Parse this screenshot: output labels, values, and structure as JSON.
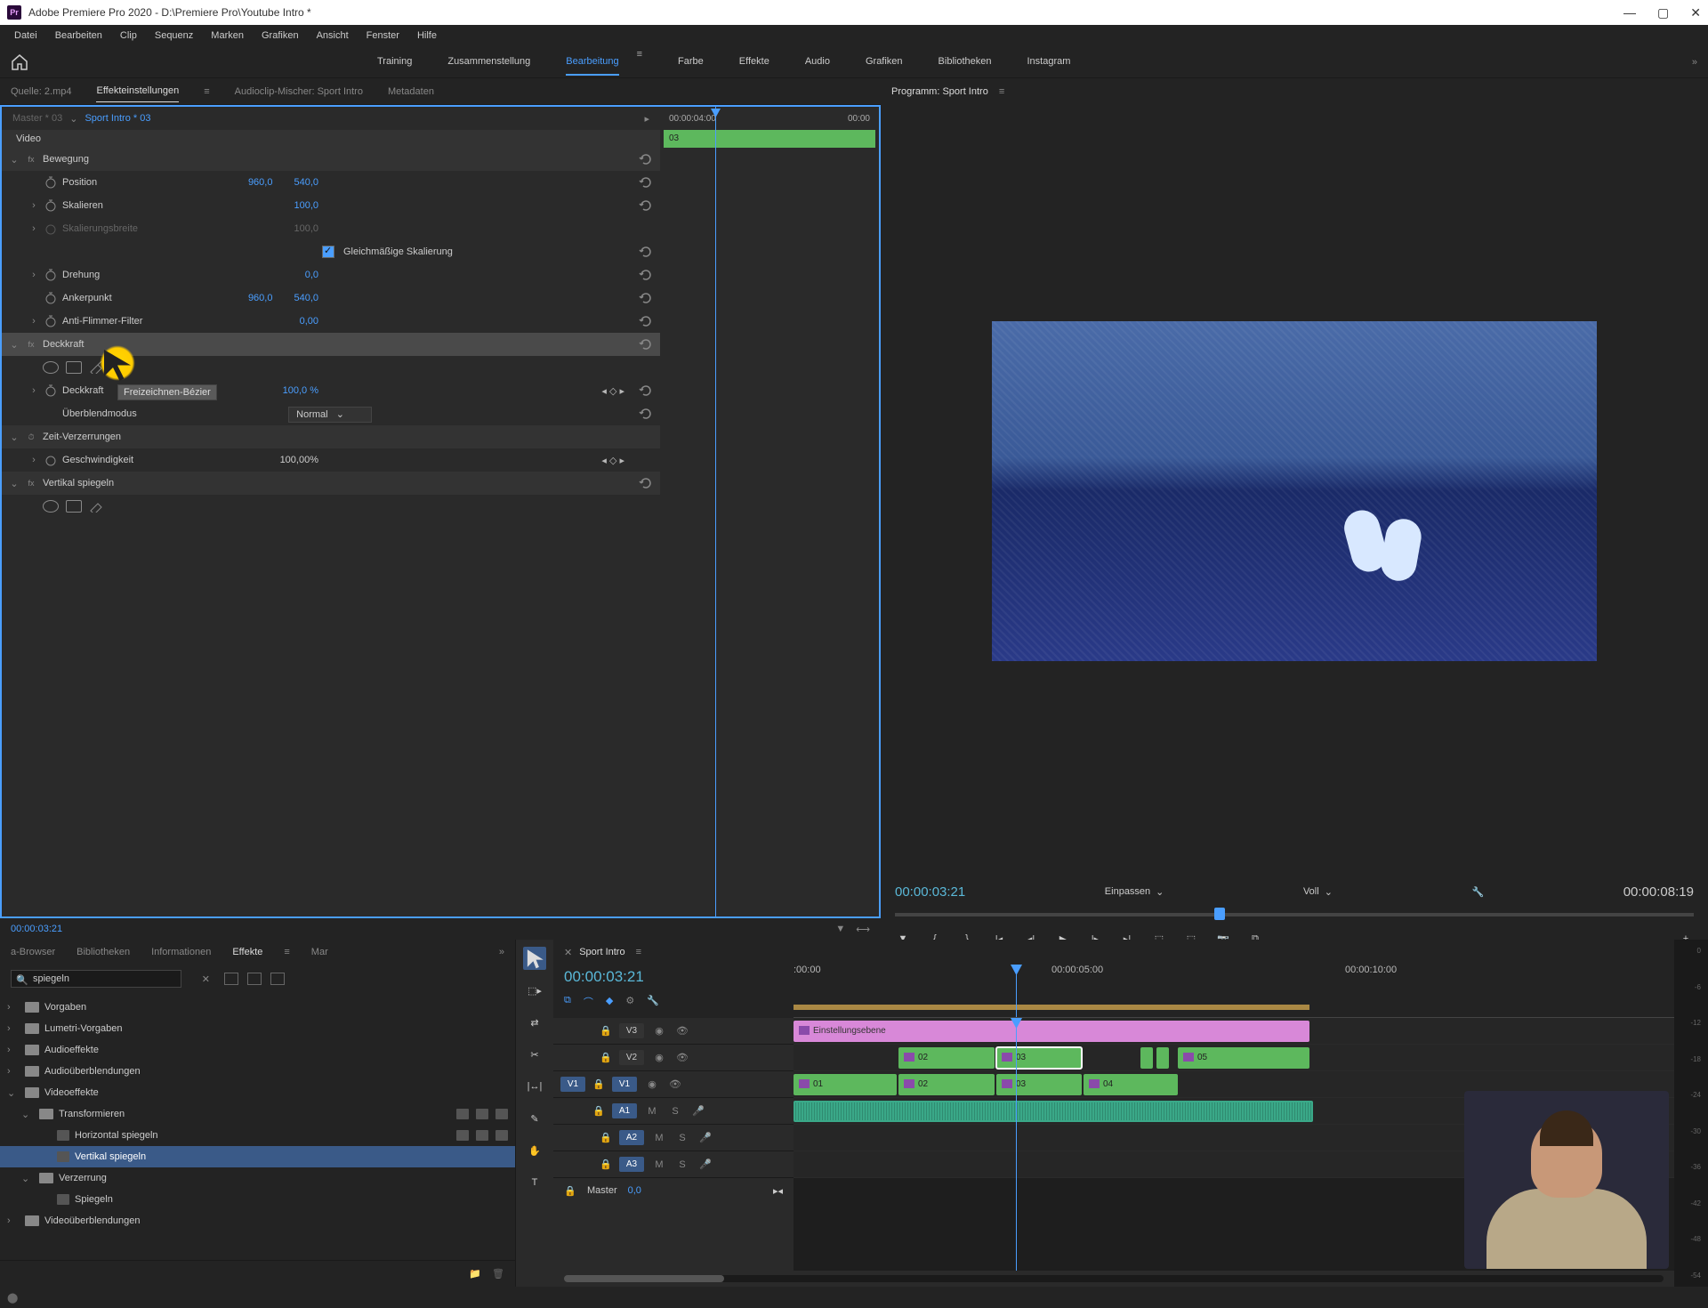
{
  "titlebar": {
    "app_icon_text": "Pr",
    "title": "Adobe Premiere Pro 2020 - D:\\Premiere Pro\\Youtube Intro *"
  },
  "menubar": [
    "Datei",
    "Bearbeiten",
    "Clip",
    "Sequenz",
    "Marken",
    "Grafiken",
    "Ansicht",
    "Fenster",
    "Hilfe"
  ],
  "workspaces": {
    "items": [
      "Training",
      "Zusammenstellung",
      "Bearbeitung",
      "Farbe",
      "Effekte",
      "Audio",
      "Grafiken",
      "Bibliotheken",
      "Instagram"
    ],
    "active": "Bearbeitung"
  },
  "source_tabs": {
    "items": [
      "Quelle: 2.mp4",
      "Effekteinstellungen",
      "Audioclip-Mischer: Sport Intro",
      "Metadaten"
    ],
    "active": "Effekteinstellungen"
  },
  "effect_controls": {
    "master": "Master * 03",
    "clip": "Sport Intro * 03",
    "video_label": "Video",
    "timeline": {
      "t1": "00:00:04:00",
      "t2": "00:00",
      "clip_label": "03"
    },
    "bewegung": {
      "label": "Bewegung",
      "position": {
        "label": "Position",
        "x": "960,0",
        "y": "540,0"
      },
      "skalieren": {
        "label": "Skalieren",
        "value": "100,0"
      },
      "skalierungsbreite": {
        "label": "Skalierungsbreite",
        "value": "100,0"
      },
      "gleichmassig": "Gleichmäßige Skalierung",
      "drehung": {
        "label": "Drehung",
        "value": "0,0"
      },
      "ankerpunkt": {
        "label": "Ankerpunkt",
        "x": "960,0",
        "y": "540,0"
      },
      "antiflimmer": {
        "label": "Anti-Flimmer-Filter",
        "value": "0,00"
      }
    },
    "deckkraft": {
      "label": "Deckkraft",
      "tooltip": "Freizeichnen-Bézier",
      "opacity": {
        "label": "Deckkraft",
        "value": "100,0 %"
      },
      "blendmode": {
        "label": "Überblendmodus",
        "value": "Normal"
      }
    },
    "zeit": {
      "label": "Zeit-Verzerrungen",
      "speed": {
        "label": "Geschwindigkeit",
        "value": "100,00%"
      }
    },
    "vertikal": {
      "label": "Vertikal spiegeln"
    },
    "footer_tc": "00:00:03:21"
  },
  "program": {
    "title": "Programm: Sport Intro",
    "tc_left": "00:00:03:21",
    "fit": "Einpassen",
    "quality": "Voll",
    "tc_right": "00:00:08:19"
  },
  "project": {
    "tabs": [
      "a-Browser",
      "Bibliotheken",
      "Informationen",
      "Effekte",
      "Mar"
    ],
    "active": "Effekte",
    "search": "spiegeln",
    "tree": {
      "vorgaben": "Vorgaben",
      "lumetri": "Lumetri-Vorgaben",
      "audioeffekte": "Audioeffekte",
      "audioueber": "Audioüberblendungen",
      "videoeffekte": "Videoeffekte",
      "transformieren": "Transformieren",
      "horizontal": "Horizontal spiegeln",
      "vertikal": "Vertikal spiegeln",
      "verzerrung": "Verzerrung",
      "spiegeln": "Spiegeln",
      "videoueber": "Videoüberblendungen"
    }
  },
  "timeline": {
    "title": "Sport Intro",
    "tc": "00:00:03:21",
    "ruler": {
      "t0": ":00:00",
      "t1": "00:00:05:00",
      "t2": "00:00:10:00"
    },
    "tracks": {
      "v3": "V3",
      "v2": "V2",
      "v1": "V1",
      "a1": "A1",
      "a2": "A2",
      "a3": "A3",
      "v1_source": "V1",
      "a1_source": "A1",
      "m": "M",
      "s": "S"
    },
    "clips": {
      "adjust": "Einstellungsebene",
      "v2_02": "02",
      "v2_03": "03",
      "v2_05": "05",
      "v1_01": "01",
      "v1_02": "02",
      "v1_03": "03",
      "v1_04": "04"
    },
    "master": {
      "label": "Master",
      "value": "0,0"
    }
  },
  "meters": {
    "labels": [
      "0",
      "-6",
      "-12",
      "-18",
      "-24",
      "-30",
      "-36",
      "-42",
      "-48",
      "-54"
    ]
  }
}
